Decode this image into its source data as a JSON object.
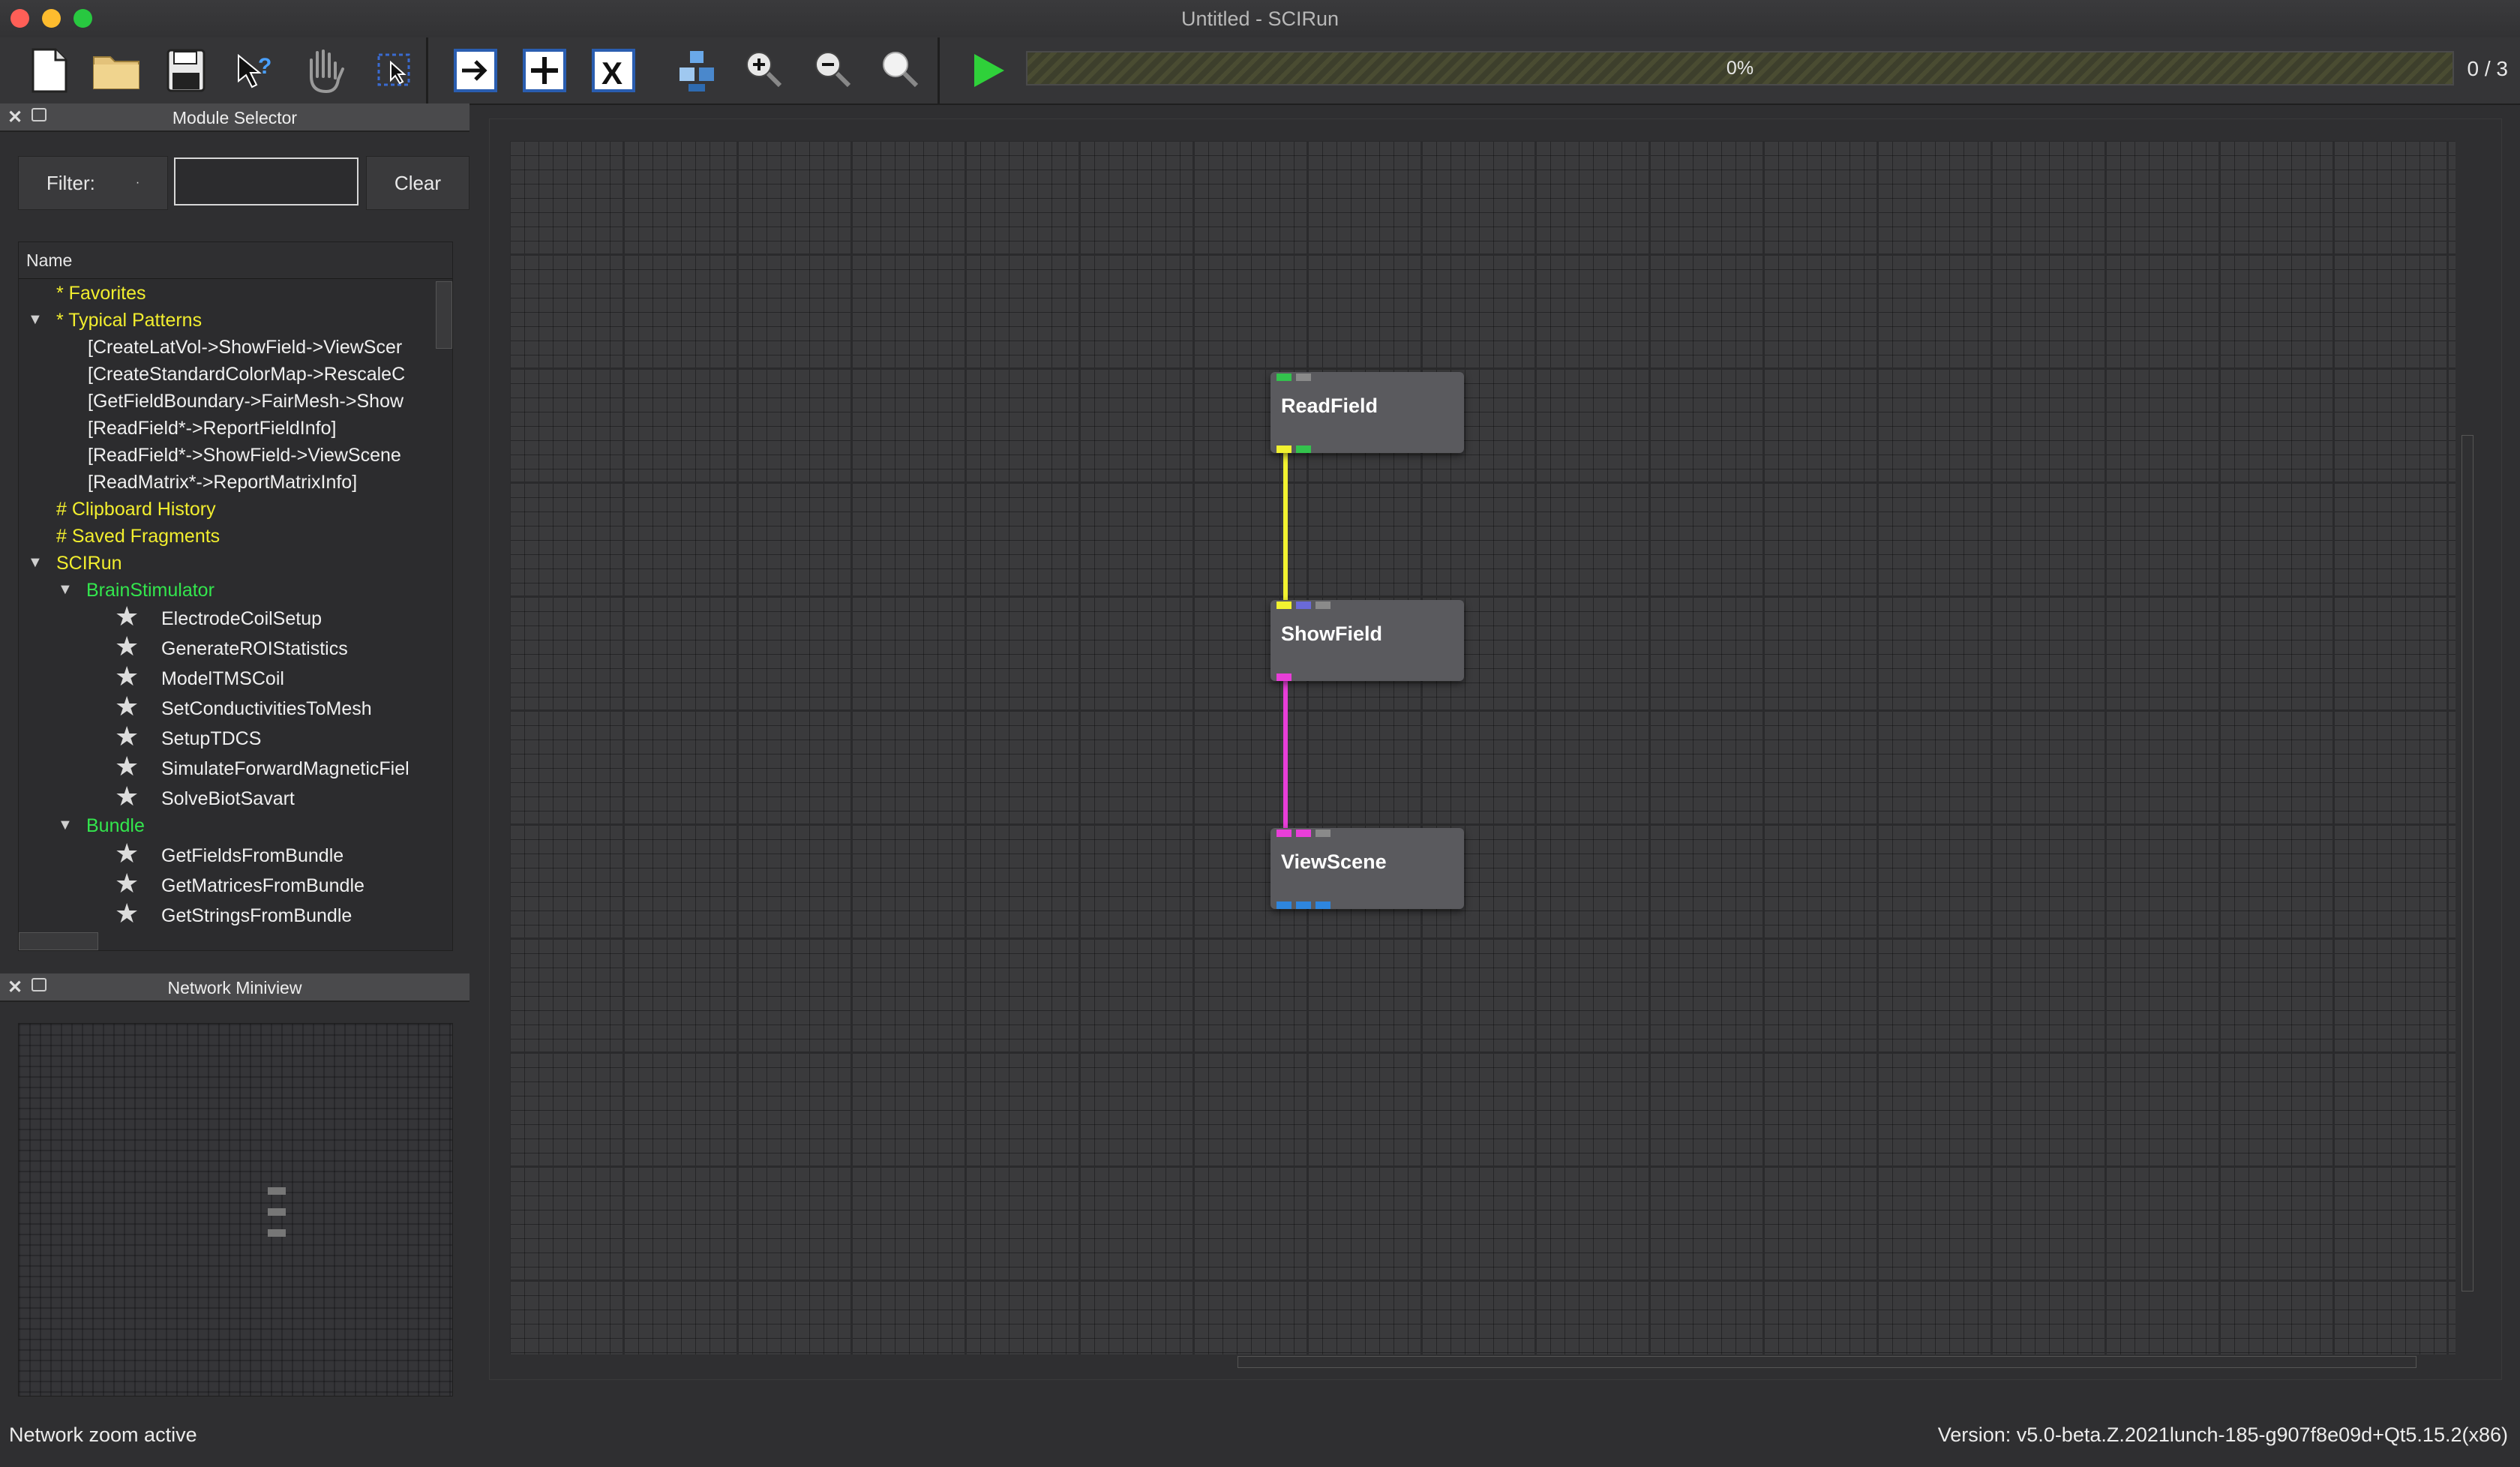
{
  "window": {
    "title": "Untitled - SCIRun"
  },
  "toolbar": {
    "progress_text": "0%",
    "progress_value": 0,
    "execution_count": "0 / 3",
    "colors": {
      "run": "#2fd13a",
      "progress": "#4a4c32"
    }
  },
  "module_selector": {
    "title": "Module Selector",
    "filter_label": "Filter:",
    "filter_value": "",
    "clear_label": "Clear",
    "column_header": "Name",
    "favorites": "* Favorites",
    "typical_patterns": "* Typical Patterns",
    "patterns": [
      "[CreateLatVol->ShowField->ViewScer",
      "[CreateStandardColorMap->RescaleC",
      "[GetFieldBoundary->FairMesh->Show",
      "[ReadField*->ReportFieldInfo]",
      "[ReadField*->ShowField->ViewScene",
      "[ReadMatrix*->ReportMatrixInfo]"
    ],
    "clipboard_history": "# Clipboard History",
    "saved_fragments": "# Saved Fragments",
    "scirun": "SCIRun",
    "brainstimulator": "BrainStimulator",
    "brain_modules": [
      "ElectrodeCoilSetup",
      "GenerateROIStatistics",
      "ModelTMSCoil",
      "SetConductivitiesToMesh",
      "SetupTDCS",
      "SimulateForwardMagneticFiel",
      "SolveBiotSavart"
    ],
    "bundle": "Bundle",
    "bundle_modules": [
      "GetFieldsFromBundle",
      "GetMatricesFromBundle",
      "GetStringsFromBundle"
    ]
  },
  "network_miniview": {
    "title": "Network Miniview"
  },
  "network": {
    "modules": [
      "ReadField",
      "ShowField",
      "ViewScene"
    ],
    "connection_colors": [
      "#f2f230",
      "#e83ed8"
    ]
  },
  "status": {
    "left": "Network zoom active",
    "right": "Version: v5.0-beta.Z.2021lunch-185-g907f8e09d+Qt5.15.2(x86)"
  }
}
